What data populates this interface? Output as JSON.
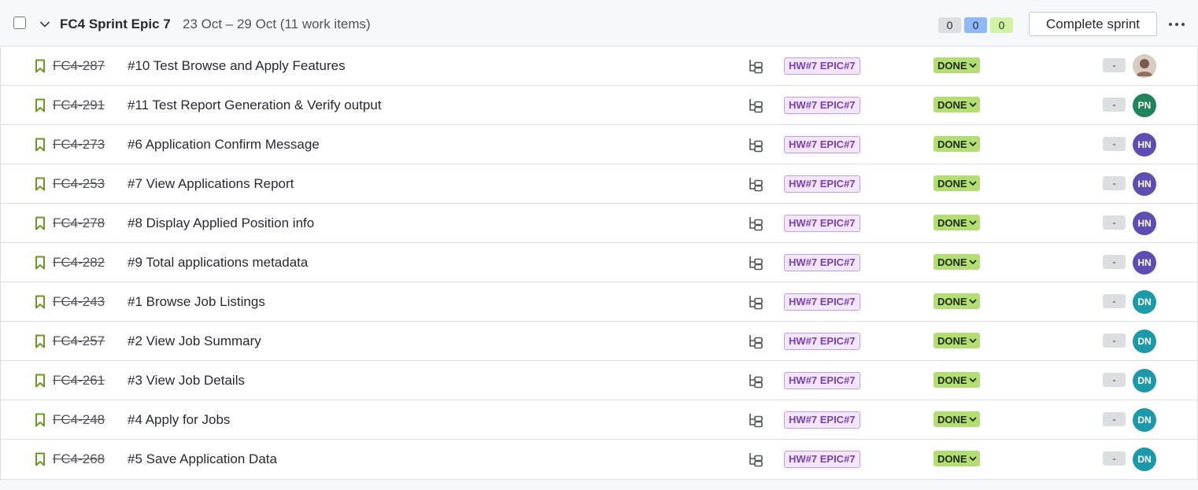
{
  "sprint": {
    "name": "FC4 Sprint Epic 7",
    "meta": "23 Oct – 29 Oct (11 work items)",
    "counts": {
      "todo": "0",
      "in_progress": "0",
      "done": "0"
    },
    "complete_label": "Complete sprint",
    "more_label": "···"
  },
  "colors": {
    "epic_bg": "#f3e6ff",
    "epic_text": "#7a3fb0",
    "done_bg": "#b3df72",
    "avatar_pn": "#1f845a",
    "avatar_hn": "#5e4db2",
    "avatar_dn": "#1d9aaa",
    "story_icon": "#6a9a23"
  },
  "rows": [
    {
      "key": "FC4-287",
      "summary": "#10 Test Browse and Apply Features",
      "epic": "HW#7 EPIC#7",
      "status": "DONE",
      "estimate": "-",
      "assignee": "",
      "avatar_type": "photo",
      "avatar_color": "#c9b7a6"
    },
    {
      "key": "FC4-291",
      "summary": "#11 Test Report Generation & Verify output",
      "epic": "HW#7 EPIC#7",
      "status": "DONE",
      "estimate": "-",
      "assignee": "PN",
      "avatar_type": "initials",
      "avatar_color": "#1f845a"
    },
    {
      "key": "FC4-273",
      "summary": "#6 Application Confirm Message",
      "epic": "HW#7 EPIC#7",
      "status": "DONE",
      "estimate": "-",
      "assignee": "HN",
      "avatar_type": "initials",
      "avatar_color": "#5e4db2"
    },
    {
      "key": "FC4-253",
      "summary": "#7 View Applications Report",
      "epic": "HW#7 EPIC#7",
      "status": "DONE",
      "estimate": "-",
      "assignee": "HN",
      "avatar_type": "initials",
      "avatar_color": "#5e4db2"
    },
    {
      "key": "FC4-278",
      "summary": "#8 Display Applied Position info",
      "epic": "HW#7 EPIC#7",
      "status": "DONE",
      "estimate": "-",
      "assignee": "HN",
      "avatar_type": "initials",
      "avatar_color": "#5e4db2"
    },
    {
      "key": "FC4-282",
      "summary": "#9 Total applications metadata",
      "epic": "HW#7 EPIC#7",
      "status": "DONE",
      "estimate": "-",
      "assignee": "HN",
      "avatar_type": "initials",
      "avatar_color": "#5e4db2"
    },
    {
      "key": "FC4-243",
      "summary": "#1 Browse Job Listings",
      "epic": "HW#7 EPIC#7",
      "status": "DONE",
      "estimate": "-",
      "assignee": "DN",
      "avatar_type": "initials",
      "avatar_color": "#1d9aaa"
    },
    {
      "key": "FC4-257",
      "summary": "#2 View Job Summary",
      "epic": "HW#7 EPIC#7",
      "status": "DONE",
      "estimate": "-",
      "assignee": "DN",
      "avatar_type": "initials",
      "avatar_color": "#1d9aaa"
    },
    {
      "key": "FC4-261",
      "summary": "#3 View Job Details",
      "epic": "HW#7 EPIC#7",
      "status": "DONE",
      "estimate": "-",
      "assignee": "DN",
      "avatar_type": "initials",
      "avatar_color": "#1d9aaa"
    },
    {
      "key": "FC4-248",
      "summary": "#4 Apply for Jobs",
      "epic": "HW#7 EPIC#7",
      "status": "DONE",
      "estimate": "-",
      "assignee": "DN",
      "avatar_type": "initials",
      "avatar_color": "#1d9aaa"
    },
    {
      "key": "FC4-268",
      "summary": "#5 Save Application Data",
      "epic": "HW#7 EPIC#7",
      "status": "DONE",
      "estimate": "-",
      "assignee": "DN",
      "avatar_type": "initials",
      "avatar_color": "#1d9aaa"
    }
  ]
}
